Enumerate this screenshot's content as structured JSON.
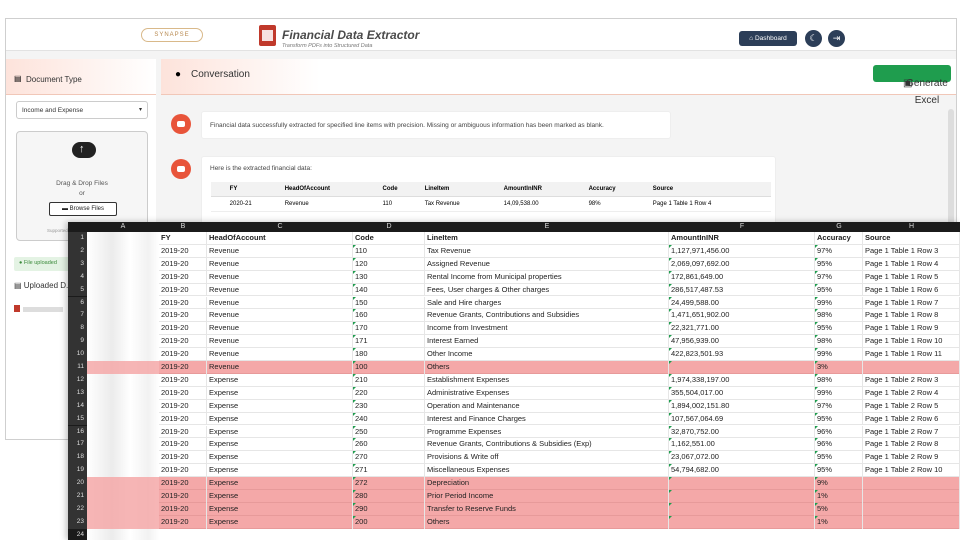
{
  "app": {
    "logo_text": "SYNAPSE",
    "title": "Financial Data Extractor",
    "subtitle": "Transform PDFs into Structured Data",
    "dashboard_label": "Dashboard",
    "theme_icon": "moon-icon",
    "logout_icon": "logout-icon"
  },
  "sidebar": {
    "doc_type_heading": "Document Type",
    "doc_type_value": "Income and Expense",
    "drag_drop": "Drag & Drop Files",
    "or": "or",
    "browse": "Browse Files",
    "supported": "Supported f...",
    "uploaded_msg": "File uploaded",
    "uploaded_heading": "Uploaded D..."
  },
  "conversation": {
    "heading": "Conversation",
    "generate_label": "Generate Excel",
    "msg1": "Financial data successfully extracted for specified line items with precision. Missing or ambiguous information has been marked as blank.",
    "msg2": "Here is the extracted financial data:",
    "table_headers": [
      "",
      "FY",
      "HeadOfAccount",
      "Code",
      "LineItem",
      "AmountInINR",
      "Accuracy",
      "Source"
    ],
    "table_row": [
      "",
      "2020-21",
      "Revenue",
      "110",
      "Tax Revenue",
      "14,09,538.00",
      "98%",
      "Page 1 Table 1 Row 4"
    ]
  },
  "sheet": {
    "columns": [
      "A",
      "B",
      "C",
      "D",
      "E",
      "F",
      "G",
      "H"
    ],
    "header_row": [
      "FY",
      "HeadOfAccount",
      "Code",
      "LineItem",
      "AmountInINR",
      "Accuracy",
      "Source"
    ],
    "rows": [
      [
        "2019-20",
        "Revenue",
        "110",
        "Tax Revenue",
        "1,127,971,456.00",
        "97%",
        "Page 1 Table 1 Row 3"
      ],
      [
        "2019-20",
        "Revenue",
        "120",
        "Assigned Revenue",
        "2,069,097,692.00",
        "95%",
        "Page 1 Table 1 Row 4"
      ],
      [
        "2019-20",
        "Revenue",
        "130",
        "Rental Income from Municipal properties",
        "172,861,649.00",
        "97%",
        "Page 1 Table 1 Row 5"
      ],
      [
        "2019-20",
        "Revenue",
        "140",
        "Fees, User charges & Other charges",
        "286,517,487.53",
        "95%",
        "Page 1 Table 1 Row 6"
      ],
      [
        "2019-20",
        "Revenue",
        "150",
        "Sale and Hire charges",
        "24,499,588.00",
        "99%",
        "Page 1 Table 1 Row 7"
      ],
      [
        "2019-20",
        "Revenue",
        "160",
        "Revenue Grants, Contributions and Subsidies",
        "1,471,651,902.00",
        "98%",
        "Page 1 Table 1 Row 8"
      ],
      [
        "2019-20",
        "Revenue",
        "170",
        "Income from Investment",
        "22,321,771.00",
        "95%",
        "Page 1 Table 1 Row 9"
      ],
      [
        "2019-20",
        "Revenue",
        "171",
        "Interest Earned",
        "47,956,939.00",
        "98%",
        "Page 1 Table 1 Row 10"
      ],
      [
        "2019-20",
        "Revenue",
        "180",
        "Other Income",
        "422,823,501.93",
        "99%",
        "Page 1 Table 1 Row 11"
      ],
      [
        "2019-20",
        "Revenue",
        "100",
        "Others",
        "",
        "3%",
        ""
      ],
      [
        "2019-20",
        "Expense",
        "210",
        "Establishment Expenses",
        "1,974,338,197.00",
        "98%",
        "Page 1 Table 2 Row 3"
      ],
      [
        "2019-20",
        "Expense",
        "220",
        "Administrative Expenses",
        "355,504,017.00",
        "99%",
        "Page 1 Table 2 Row 4"
      ],
      [
        "2019-20",
        "Expense",
        "230",
        "Operation and Maintenance",
        "1,894,002,151.80",
        "97%",
        "Page 1 Table 2 Row 5"
      ],
      [
        "2019-20",
        "Expense",
        "240",
        "Interest and Finance Charges",
        "107,567,064.69",
        "95%",
        "Page 1 Table 2 Row 6"
      ],
      [
        "2019-20",
        "Expense",
        "250",
        "Programme Expenses",
        "32,870,752.00",
        "96%",
        "Page 1 Table 2 Row 7"
      ],
      [
        "2019-20",
        "Expense",
        "260",
        "Revenue Grants, Contributions & Subsidies (Exp)",
        "1,162,551.00",
        "96%",
        "Page 1 Table 2 Row 8"
      ],
      [
        "2019-20",
        "Expense",
        "270",
        "Provisions & Write off",
        "23,067,072.00",
        "95%",
        "Page 1 Table 2 Row 9"
      ],
      [
        "2019-20",
        "Expense",
        "271",
        "Miscellaneous Expenses",
        "54,794,682.00",
        "95%",
        "Page 1 Table 2 Row 10"
      ],
      [
        "2019-20",
        "Expense",
        "272",
        "Depreciation",
        "",
        "9%",
        ""
      ],
      [
        "2019-20",
        "Expense",
        "280",
        "Prior Period Income",
        "",
        "1%",
        ""
      ],
      [
        "2019-20",
        "Expense",
        "290",
        "Transfer to Reserve Funds",
        "",
        "5%",
        ""
      ],
      [
        "2019-20",
        "Expense",
        "200",
        "Others",
        "",
        "1%",
        ""
      ]
    ],
    "highlighted_rows": [
      10,
      19,
      20,
      21,
      22
    ],
    "highlight_color": "#f4a8a8",
    "last_row_number": "24"
  }
}
